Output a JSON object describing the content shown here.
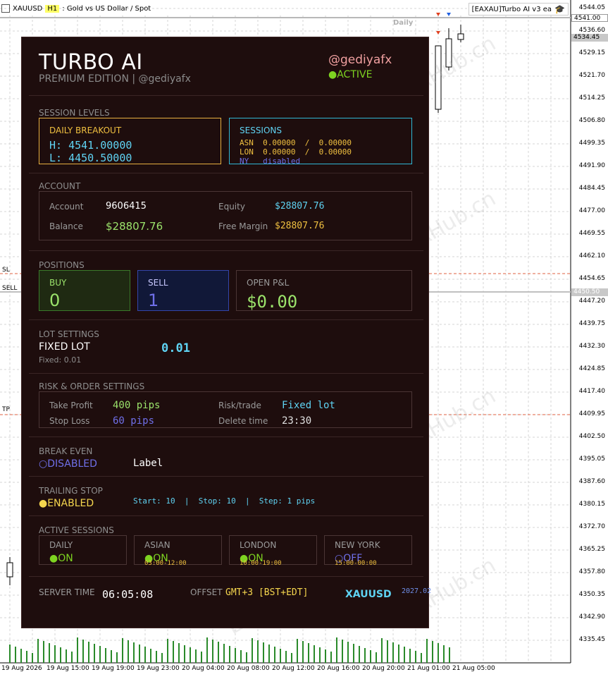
{
  "window": {
    "title_prefix": "XAUUSD",
    "title_highlight": "H1",
    "title_suffix": ": Gold vs US Dollar / Spot",
    "ea_badge": "[EAXAU]Turbo AI v3 ea"
  },
  "chart": {
    "daily_tag": "Daily",
    "price_axis": [
      "4544.05",
      "4536.60",
      "4529.15",
      "4521.70",
      "4514.25",
      "4506.80",
      "4499.35",
      "4491.90",
      "4484.45",
      "4477.00",
      "4469.55",
      "4462.10",
      "4454.65",
      "4447.20",
      "4439.75",
      "4432.30",
      "4424.85",
      "4417.40",
      "4409.95",
      "4402.50",
      "4395.05",
      "4387.60",
      "4380.15",
      "4372.70",
      "4365.25",
      "4357.80",
      "4350.35",
      "4342.90",
      "4335.45"
    ],
    "price_tag_top": "4541.00",
    "price_tag_bid": "4534.45",
    "price_tag_sell": "4450.50",
    "time_axis": [
      "19 Aug 2026",
      "19 Aug 15:00",
      "19 Aug 19:00",
      "19 Aug 23:00",
      "20 Aug 04:00",
      "20 Aug 08:00",
      "20 Aug 12:00",
      "20 Aug 16:00",
      "20 Aug 20:00",
      "21 Aug 01:00",
      "21 Aug 05:00"
    ],
    "level_sl": "SL",
    "level_sell": "SELL",
    "level_tp": "TP",
    "watermark": "EAHub.cn"
  },
  "panel": {
    "brand": "TURBO AI",
    "edition": "PREMIUM EDITION  |  @gediyafx",
    "handle": "@gediyafx",
    "status": "●ACTIVE",
    "session_levels": {
      "title": "SESSION LEVELS",
      "daily_breakout_title": "DAILY BREAKOUT",
      "high": "H: 4541.00000",
      "low": "L: 4450.50000",
      "sessions_title": "SESSIONS",
      "asn": "ASN  0.00000  /  0.00000",
      "lon": "LON  0.00000  /  0.00000",
      "ny": "NY   disabled"
    },
    "account": {
      "title": "ACCOUNT",
      "account_label": "Account",
      "account_value": "9606415",
      "equity_label": "Equity",
      "equity_value": "$28807.76",
      "balance_label": "Balance",
      "balance_value": "$28807.76",
      "free_margin_label": "Free Margin",
      "free_margin_value": "$28807.76"
    },
    "positions": {
      "title": "POSITIONS",
      "buy_label": "BUY",
      "buy_value": "0",
      "sell_label": "SELL",
      "sell_value": "1",
      "pnl_label": "OPEN P&L",
      "pnl_value": "$0.00"
    },
    "lot_settings": {
      "title": "LOT SETTINGS",
      "mode": "FIXED LOT",
      "sub": "Fixed: 0.01",
      "value": "0.01"
    },
    "risk": {
      "title": "RISK & ORDER SETTINGS",
      "tp_label": "Take Profit",
      "tp_value": "400 pips",
      "sl_label": "Stop Loss",
      "sl_value": "60 pips",
      "risk_label": "Risk/trade",
      "risk_value": "Fixed lot",
      "delete_label": "Delete time",
      "delete_value": "23:30"
    },
    "break_even": {
      "title": "BREAK EVEN",
      "status": "○DISABLED",
      "label": "Label"
    },
    "trailing": {
      "title": "TRAILING STOP",
      "status": "●ENABLED",
      "detail": "Start: 10  |  Stop: 10  |  Step: 1 pips"
    },
    "active_sessions": {
      "title": "ACTIVE SESSIONS",
      "items": [
        {
          "name": "DAILY",
          "status": "●ON",
          "time": ""
        },
        {
          "name": "ASIAN",
          "status": "●ON",
          "time": "03:00-12:00"
        },
        {
          "name": "LONDON",
          "status": "●ON",
          "time": "10:00-19:00"
        },
        {
          "name": "NEW YORK",
          "status": "○OFF",
          "time": "15:00-00:00"
        }
      ]
    },
    "footer": {
      "server_label": "SERVER TIME",
      "server_value": "06:05:08",
      "offset_label": "OFFSET",
      "offset_value": "GMT+3 [BST+EDT]",
      "symbol": "XAUUSD",
      "build": "2027.02"
    }
  }
}
